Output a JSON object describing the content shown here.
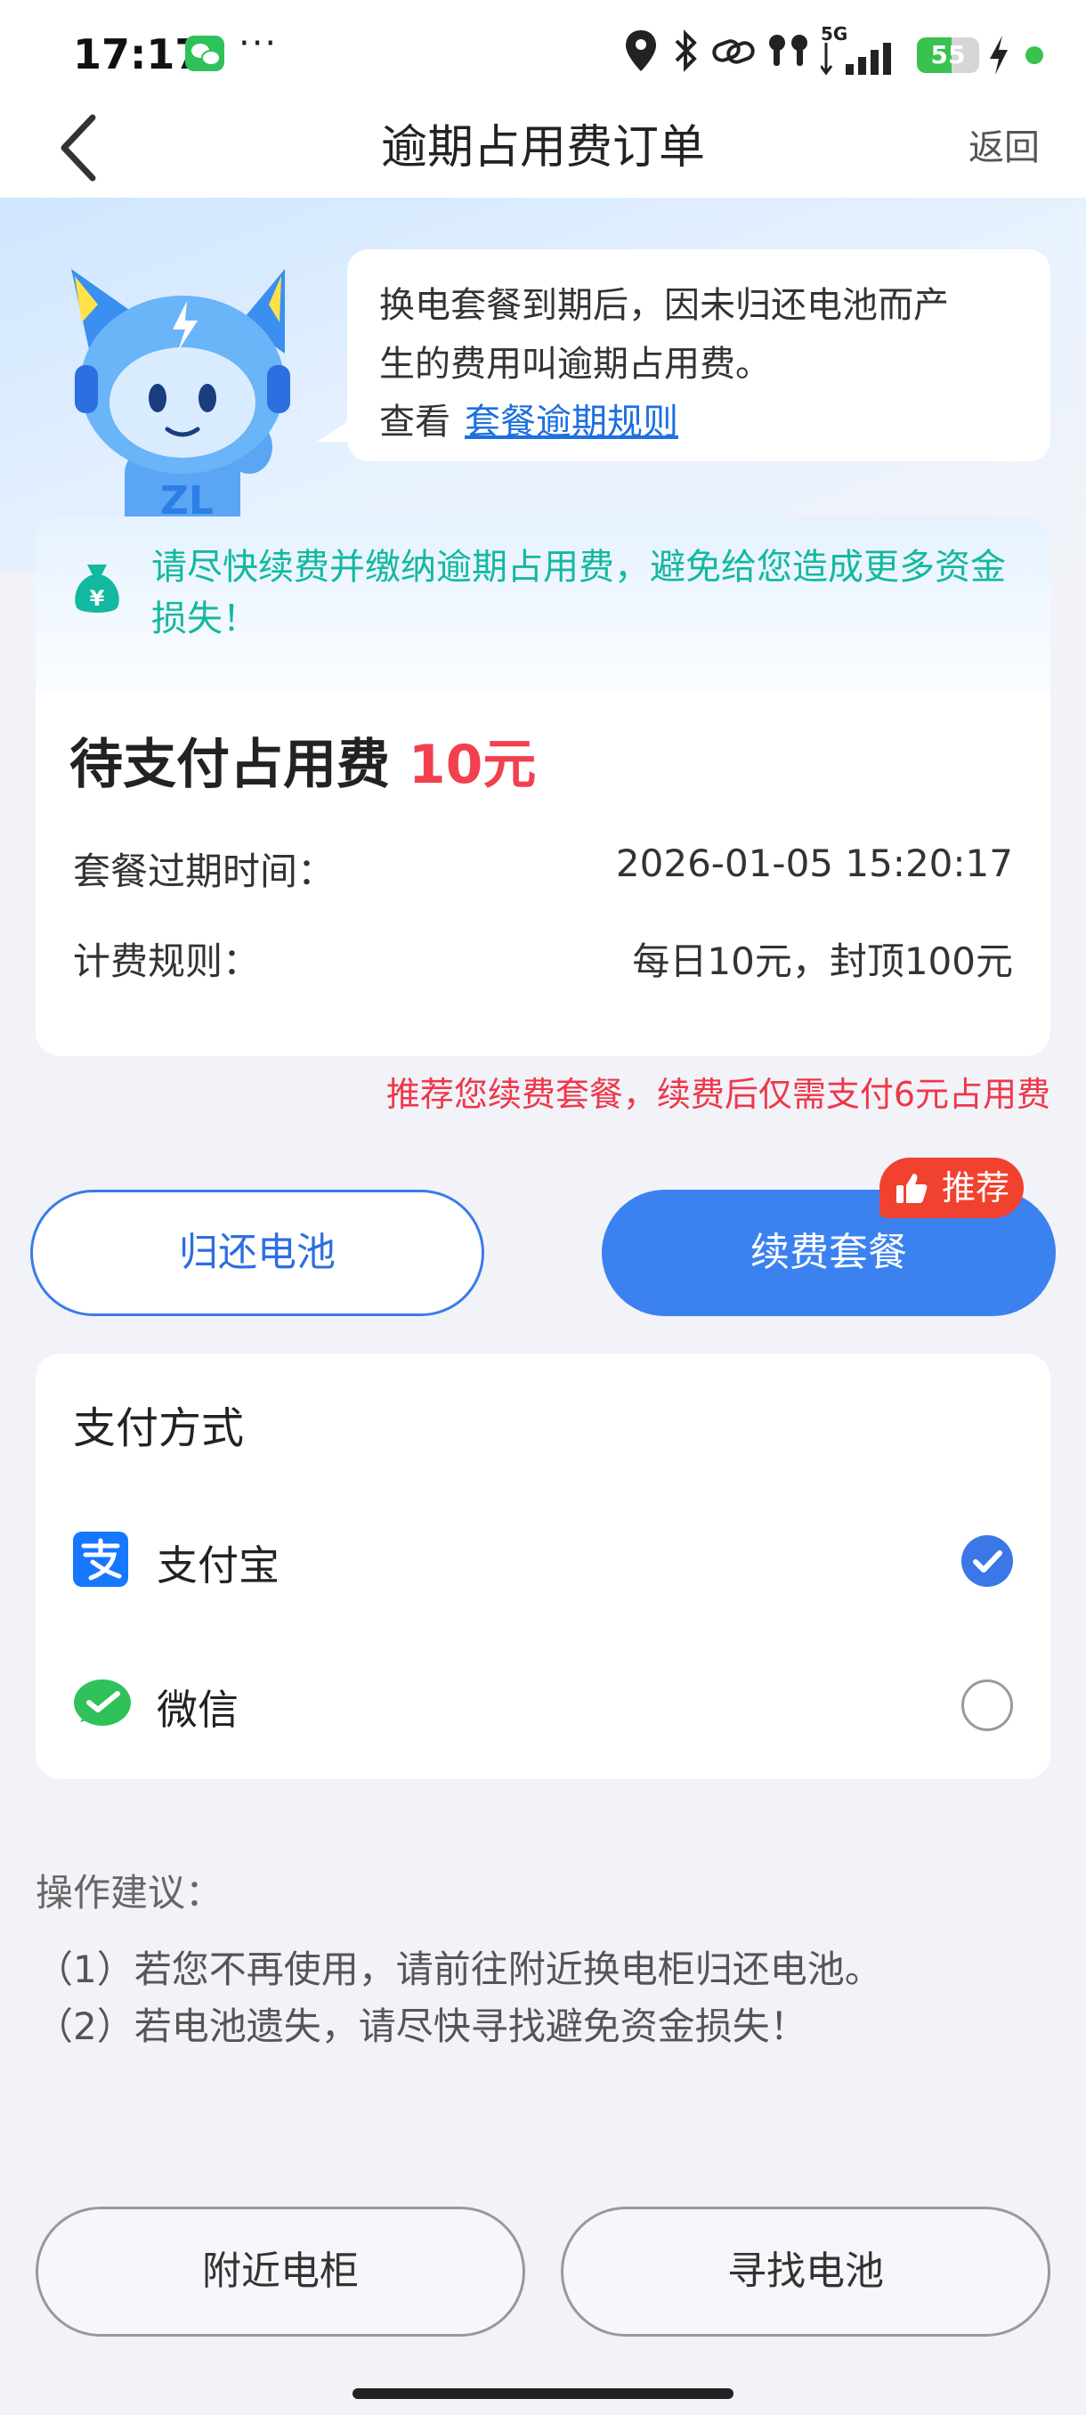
{
  "status_bar": {
    "time": "17:17",
    "more": "···",
    "network": "5G",
    "battery": "55",
    "battery_level": 0.55,
    "icons": [
      "wechat-icon",
      "location-icon",
      "bluetooth-icon",
      "link-icon",
      "earbuds-icon",
      "signal-icon",
      "battery-icon",
      "charging-icon"
    ]
  },
  "nav": {
    "title": "逾期占用费订单",
    "return_label": "返回"
  },
  "hero": {
    "text_line1": "换电套餐到期后，因未归还电池而产",
    "text_line2": "生的费用叫逾期占用费。",
    "view_prefix": "查看",
    "link_text": "套餐逾期规则"
  },
  "fee_card": {
    "warning": "请尽快续费并缴纳逾期占用费，避免给您造成更多资金损失！",
    "title": "待支付占用费",
    "amount": "10元",
    "expire_label": "套餐过期时间：",
    "expire_value": "2026-01-05 15:20:17",
    "rule_label": "计费规则：",
    "rule_value": "每日10元，封顶100元"
  },
  "recommend_note": "推荐您续费套餐，续费后仅需支付6元占用费",
  "actions": {
    "return_battery": "归还电池",
    "renew_plan": "续费套餐",
    "recommend_tag": "推荐"
  },
  "payment": {
    "title": "支付方式",
    "options": [
      {
        "label": "支付宝",
        "selected": true
      },
      {
        "label": "微信",
        "selected": false
      }
    ]
  },
  "advice": {
    "title": "操作建议：",
    "items": [
      "（1）若您不再使用，请前往附近换电柜归还电池。",
      "（2）若电池遗失，请尽快寻找避免资金损失！"
    ]
  },
  "bottom": {
    "nearby_cabinet": "附近电柜",
    "find_battery": "寻找电池"
  },
  "colors": {
    "primary_blue": "#3b82f0",
    "alert_red": "#f2404f",
    "teal": "#13b8a0",
    "alipay_blue": "#1677ff",
    "wechat_green": "#2fc15a"
  }
}
